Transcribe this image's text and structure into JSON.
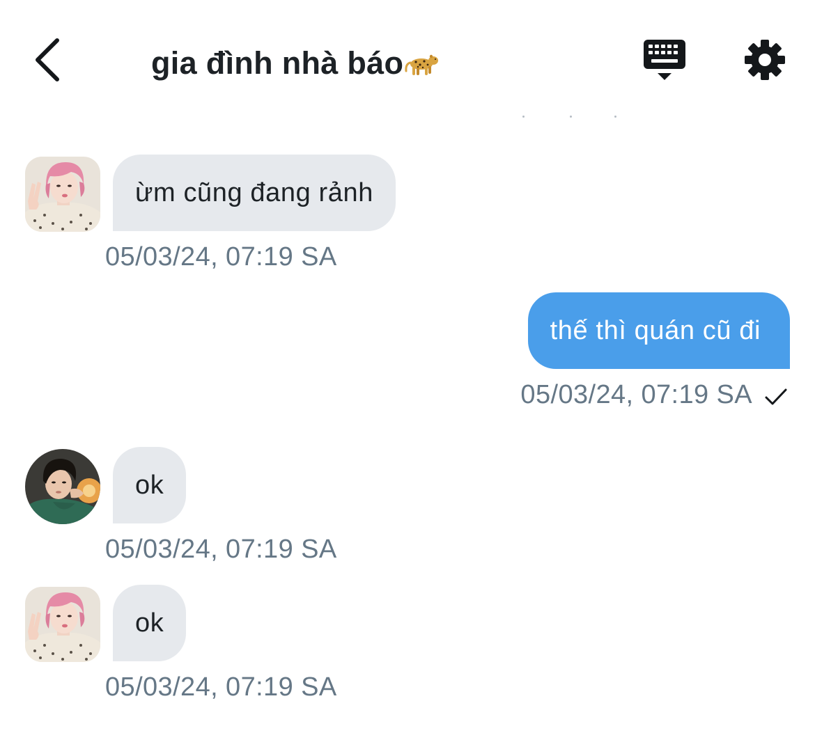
{
  "header": {
    "title": "gia đình nhà báo",
    "title_emoji": "leopard-emoji"
  },
  "messages": [
    {
      "direction": "incoming",
      "sender_avatar": "pink-hair-avatar",
      "text": "ừm cũng đang rảnh",
      "timestamp": "05/03/24, 07:19 SA"
    },
    {
      "direction": "outgoing",
      "text": "thế thì quán cũ đi",
      "timestamp": "05/03/24, 07:19 SA",
      "status_icon": "checkmark-icon"
    },
    {
      "direction": "incoming",
      "sender_avatar": "dark-hair-avatar",
      "text": "ok",
      "timestamp": "05/03/24, 07:19 SA"
    },
    {
      "direction": "incoming",
      "sender_avatar": "pink-hair-avatar",
      "text": "ok",
      "timestamp": "05/03/24, 07:19 SA"
    }
  ],
  "colors": {
    "accent": "#4a9eea",
    "incoming_bubble": "#e6e9ed",
    "timestamp": "#657786",
    "text": "#1d2226"
  }
}
